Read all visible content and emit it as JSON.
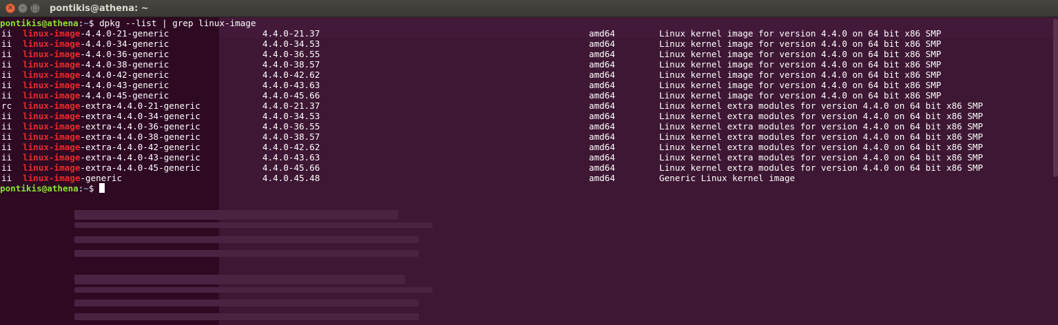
{
  "window": {
    "title": "pontikis@athena: ~",
    "buttons": {
      "close": "×",
      "minimize": "–",
      "maximize": "□"
    }
  },
  "prompt": {
    "user_host": "pontikis@athena",
    "sep": ":",
    "path": "~",
    "symbol": "$ "
  },
  "command": "dpkg --list | grep linux-image",
  "match": "linux-image",
  "packages": [
    {
      "status": "ii",
      "pkg_rest": "-4.4.0-21-generic",
      "version": "4.4.0-21.37",
      "arch": "amd64",
      "description": "Linux kernel image for version 4.4.0 on 64 bit x86 SMP"
    },
    {
      "status": "ii",
      "pkg_rest": "-4.4.0-34-generic",
      "version": "4.4.0-34.53",
      "arch": "amd64",
      "description": "Linux kernel image for version 4.4.0 on 64 bit x86 SMP"
    },
    {
      "status": "ii",
      "pkg_rest": "-4.4.0-36-generic",
      "version": "4.4.0-36.55",
      "arch": "amd64",
      "description": "Linux kernel image for version 4.4.0 on 64 bit x86 SMP"
    },
    {
      "status": "ii",
      "pkg_rest": "-4.4.0-38-generic",
      "version": "4.4.0-38.57",
      "arch": "amd64",
      "description": "Linux kernel image for version 4.4.0 on 64 bit x86 SMP"
    },
    {
      "status": "ii",
      "pkg_rest": "-4.4.0-42-generic",
      "version": "4.4.0-42.62",
      "arch": "amd64",
      "description": "Linux kernel image for version 4.4.0 on 64 bit x86 SMP"
    },
    {
      "status": "ii",
      "pkg_rest": "-4.4.0-43-generic",
      "version": "4.4.0-43.63",
      "arch": "amd64",
      "description": "Linux kernel image for version 4.4.0 on 64 bit x86 SMP"
    },
    {
      "status": "ii",
      "pkg_rest": "-4.4.0-45-generic",
      "version": "4.4.0-45.66",
      "arch": "amd64",
      "description": "Linux kernel image for version 4.4.0 on 64 bit x86 SMP"
    },
    {
      "status": "rc",
      "pkg_rest": "-extra-4.4.0-21-generic",
      "version": "4.4.0-21.37",
      "arch": "amd64",
      "description": "Linux kernel extra modules for version 4.4.0 on 64 bit x86 SMP"
    },
    {
      "status": "ii",
      "pkg_rest": "-extra-4.4.0-34-generic",
      "version": "4.4.0-34.53",
      "arch": "amd64",
      "description": "Linux kernel extra modules for version 4.4.0 on 64 bit x86 SMP"
    },
    {
      "status": "ii",
      "pkg_rest": "-extra-4.4.0-36-generic",
      "version": "4.4.0-36.55",
      "arch": "amd64",
      "description": "Linux kernel extra modules for version 4.4.0 on 64 bit x86 SMP"
    },
    {
      "status": "ii",
      "pkg_rest": "-extra-4.4.0-38-generic",
      "version": "4.4.0-38.57",
      "arch": "amd64",
      "description": "Linux kernel extra modules for version 4.4.0 on 64 bit x86 SMP"
    },
    {
      "status": "ii",
      "pkg_rest": "-extra-4.4.0-42-generic",
      "version": "4.4.0-42.62",
      "arch": "amd64",
      "description": "Linux kernel extra modules for version 4.4.0 on 64 bit x86 SMP"
    },
    {
      "status": "ii",
      "pkg_rest": "-extra-4.4.0-43-generic",
      "version": "4.4.0-43.63",
      "arch": "amd64",
      "description": "Linux kernel extra modules for version 4.4.0 on 64 bit x86 SMP"
    },
    {
      "status": "ii",
      "pkg_rest": "-extra-4.4.0-45-generic",
      "version": "4.4.0-45.66",
      "arch": "amd64",
      "description": "Linux kernel extra modules for version 4.4.0 on 64 bit x86 SMP"
    },
    {
      "status": "ii",
      "pkg_rest": "-generic",
      "version": "4.4.0.45.48",
      "arch": "amd64",
      "description": "Generic Linux kernel image"
    }
  ],
  "colors": {
    "background": "#300a24",
    "prompt_user": "#8ae234",
    "prompt_path": "#729fcf",
    "grep_match": "#ef2929",
    "titlebar": "#3c3b37"
  }
}
